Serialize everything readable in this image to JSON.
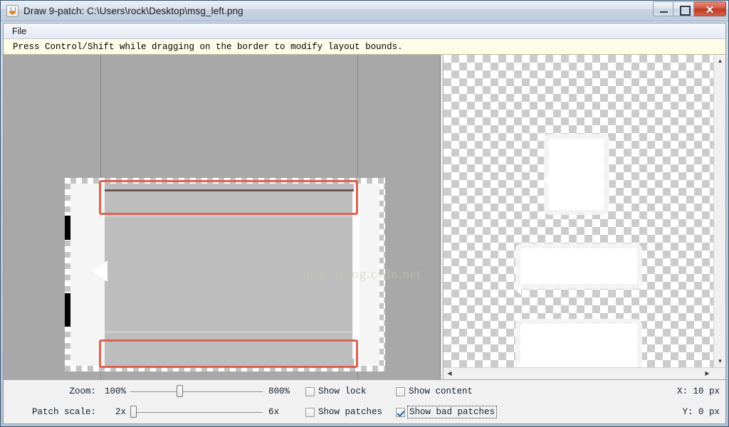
{
  "window": {
    "title": "Draw 9-patch: C:\\Users\\rock\\Desktop\\msg_left.png",
    "app_icon": "java-coffee-cup-icon",
    "controls": {
      "minimize": "minimize-icon",
      "maximize": "maximize-icon",
      "close": "✕"
    }
  },
  "menu": {
    "items": [
      {
        "label": "File"
      }
    ]
  },
  "hint": {
    "text": "Press Control/Shift while dragging on the border to modify layout bounds."
  },
  "editor": {
    "watermark": "http://blog.csdn.net",
    "guides": [
      136,
      497
    ],
    "bad_patches": 2,
    "patch_markers": 2
  },
  "preview": {
    "bubbles": 3,
    "scroll": {
      "up": "▲",
      "down": "▼",
      "left": "◀",
      "right": "▶"
    }
  },
  "toolbar": {
    "zoom": {
      "label": "Zoom:",
      "min_label": "100%",
      "max_label": "800%",
      "value_percent": 37
    },
    "patch_scale": {
      "label": "Patch scale:",
      "min_label": "2x",
      "max_label": "6x",
      "value_percent": 0
    },
    "checkboxes": [
      {
        "name": "show-lock",
        "label": "Show lock",
        "checked": false,
        "focused": false
      },
      {
        "name": "show-patches",
        "label": "Show patches",
        "checked": false,
        "focused": false
      },
      {
        "name": "show-content",
        "label": "Show content",
        "checked": false,
        "focused": false
      },
      {
        "name": "show-bad-patches",
        "label": "Show bad patches",
        "checked": true,
        "focused": true
      }
    ],
    "cursor": {
      "x_label": "X: 10 px",
      "y_label": "Y:  0 px"
    }
  },
  "colors": {
    "canvas_bg": "#a8a8a8",
    "bad_patch": "#e06050",
    "hint_bg": "#fdfde7",
    "close_button": "#bc3a24"
  }
}
